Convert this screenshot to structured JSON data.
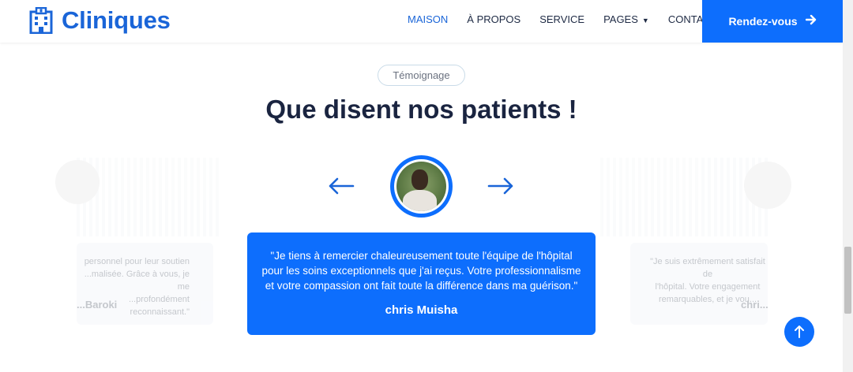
{
  "header": {
    "brand_name": "Cliniques",
    "nav": [
      {
        "label": "MAISON",
        "active": true
      },
      {
        "label": "À PROPOS",
        "active": false
      },
      {
        "label": "SERVICE",
        "active": false
      },
      {
        "label": "PAGES",
        "active": false,
        "has_dropdown": true
      },
      {
        "label": "CONTACT",
        "active": false
      }
    ],
    "cta_label": "Rendez-vous"
  },
  "section": {
    "badge": "Témoignage",
    "title": "Que disent nos patients !"
  },
  "carousel": {
    "current": {
      "quote": "\"Je tiens à remercier chaleureusement toute l'équipe de l'hôpital pour les soins exceptionnels que j'ai reçus. Votre professionnalisme et votre compassion ont fait toute la différence dans ma guérison.\"",
      "name": "chris Muisha"
    },
    "prev": {
      "quote_lines": [
        "personnel pour leur soutien",
        "...malisée. Grâce à vous, je me",
        "...profondément reconnaissant.\""
      ],
      "name": "...Baroki"
    },
    "next": {
      "quote_lines": [
        "\"Je suis extrêmement satisfait de",
        "l'hôpital. Votre engagement",
        "remarquables, et je vou..."
      ],
      "name": "chri..."
    }
  },
  "colors": {
    "primary": "#0d6efd",
    "brand": "#1a65d8",
    "heading": "#1a2440"
  },
  "icons": {
    "brand": "hospital-building-icon",
    "cta": "arrow-right-icon",
    "prev": "arrow-left-icon",
    "next": "arrow-right-icon",
    "to_top": "arrow-up-icon",
    "dropdown": "chevron-down-icon"
  }
}
